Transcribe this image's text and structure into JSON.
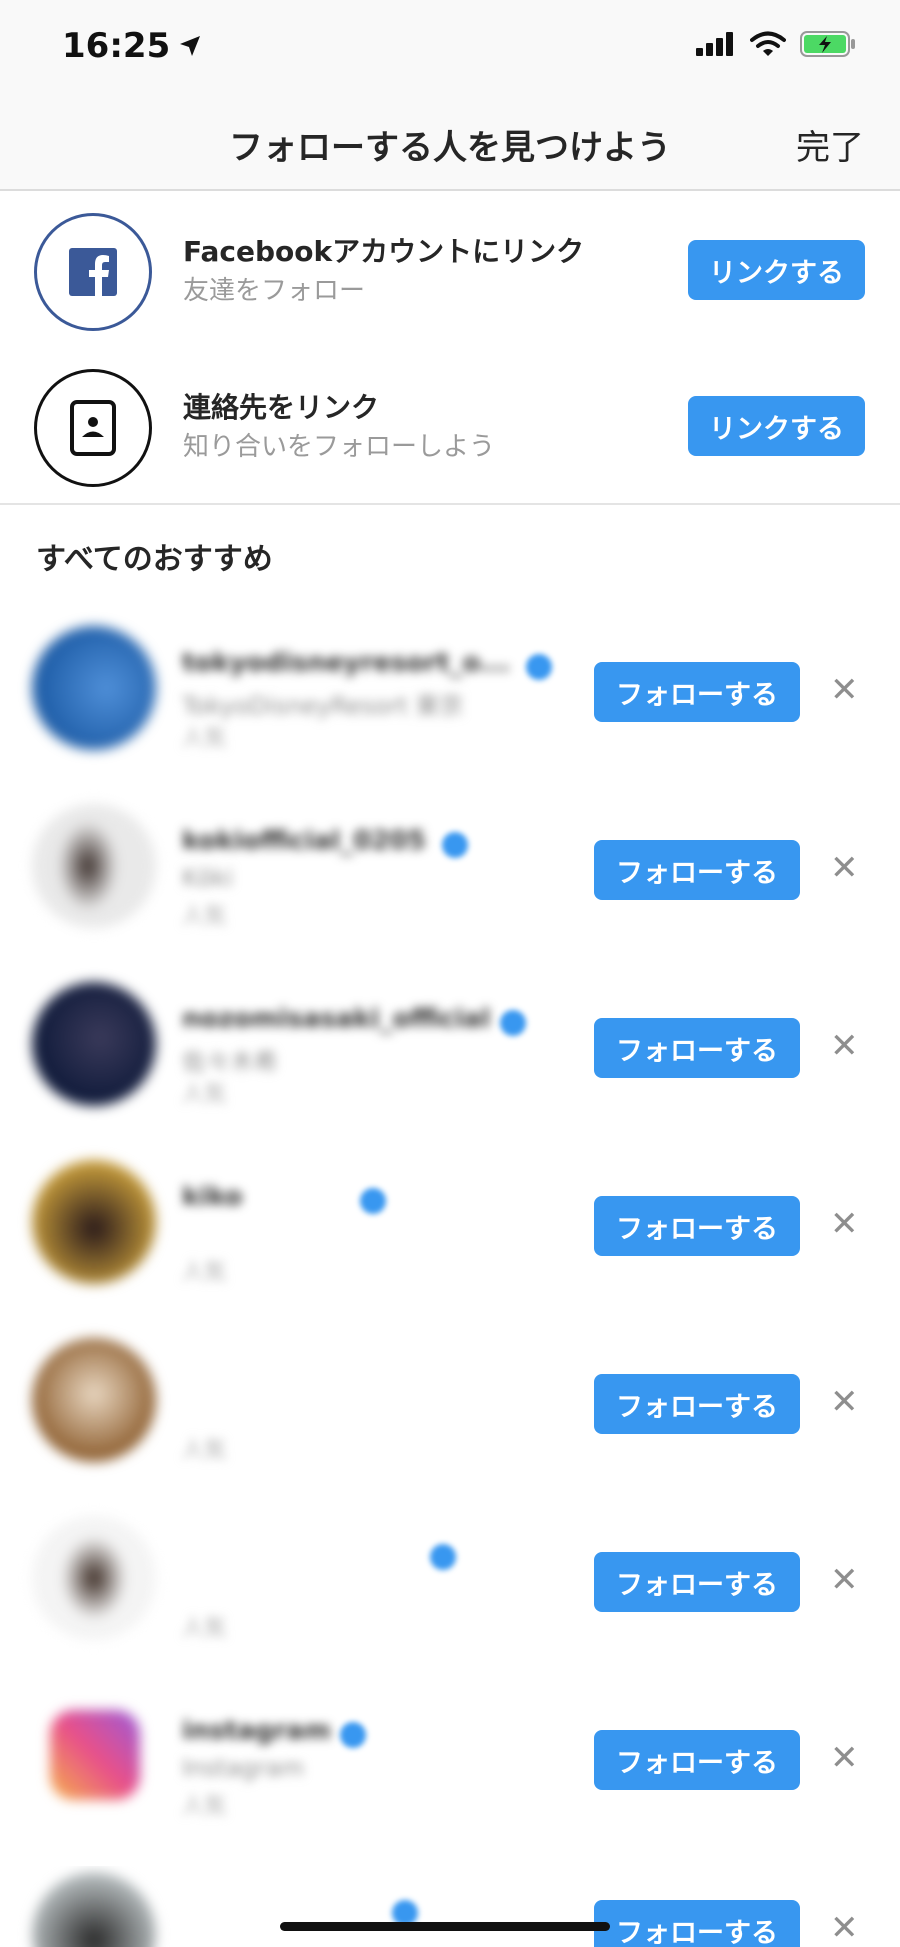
{
  "status": {
    "time": "16:25"
  },
  "nav": {
    "title": "フォローする人を見つけよう",
    "done": "完了"
  },
  "links": [
    {
      "title": "Facebookアカウントにリンク",
      "subtitle": "友達をフォロー",
      "button": "リンクする",
      "icon": "facebook-icon"
    },
    {
      "title": "連絡先をリンク",
      "subtitle": "知り合いをフォローしよう",
      "button": "リンクする",
      "icon": "contacts-icon"
    }
  ],
  "section_title": "すべてのおすすめ",
  "follow_label": "フォローする",
  "dismiss_glyph": "✕",
  "suggestions": [
    {
      "username": "tokyodisneyresort_o...",
      "fullname": "TokyoDisneyResort 東京",
      "tag": "人気",
      "verified": true
    },
    {
      "username": "kokiofficial_0205",
      "fullname": "Kōki",
      "tag": "人気",
      "verified": true
    },
    {
      "username": "nozomisasaki_official",
      "fullname": "佐々木希",
      "tag": "人気",
      "verified": true
    },
    {
      "username": "kiko",
      "fullname": "",
      "tag": "人気",
      "verified": true
    },
    {
      "username": "",
      "fullname": "",
      "tag": "人気",
      "verified": false
    },
    {
      "username": "",
      "fullname": "",
      "tag": "人気",
      "verified": true
    },
    {
      "username": "instagram",
      "fullname": "Instagram",
      "tag": "人気",
      "verified": true
    },
    {
      "username": "",
      "fullname": "",
      "tag": "",
      "verified": true
    }
  ],
  "colors": {
    "accent": "#3897f0",
    "facebook": "#3b5998"
  }
}
